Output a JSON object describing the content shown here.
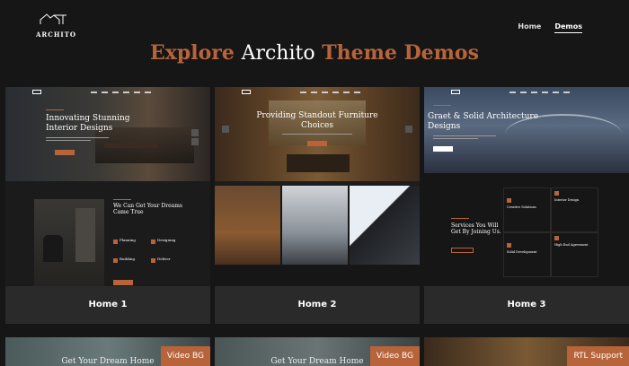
{
  "header": {
    "logo_text": "ARCHITO",
    "nav": [
      "Home",
      "Demos"
    ]
  },
  "headline": {
    "part1": "Explore",
    "part2": "Archito",
    "part3": "Theme Demos"
  },
  "demos": [
    {
      "label": "Home 1",
      "hero_title": "Innovating Stunning Interior Designs",
      "section_title": "We Can Get Your Dreams Came True",
      "features": [
        "Planning",
        "Designing",
        "Building",
        "Deliver"
      ]
    },
    {
      "label": "Home 2",
      "hero_title": "Providing Standout Furniture Choices"
    },
    {
      "label": "Home 3",
      "hero_title": "Graet & Solid Architecture Designs",
      "section_title": "Services You Will Get By Joining Us.",
      "services": [
        "Creative Solutions",
        "Interior Design",
        "Solid Development",
        "High End Agreement"
      ]
    }
  ],
  "bottom_cards": [
    {
      "title": "Get Your Dream Home",
      "badge": "Video BG"
    },
    {
      "title": "Get Your Dream Home",
      "badge": "Video BG"
    },
    {
      "title": "",
      "badge": "RTL Support"
    }
  ],
  "colors": {
    "accent": "#b8643a",
    "background": "#161616",
    "label_bg": "#2a2a2a"
  }
}
